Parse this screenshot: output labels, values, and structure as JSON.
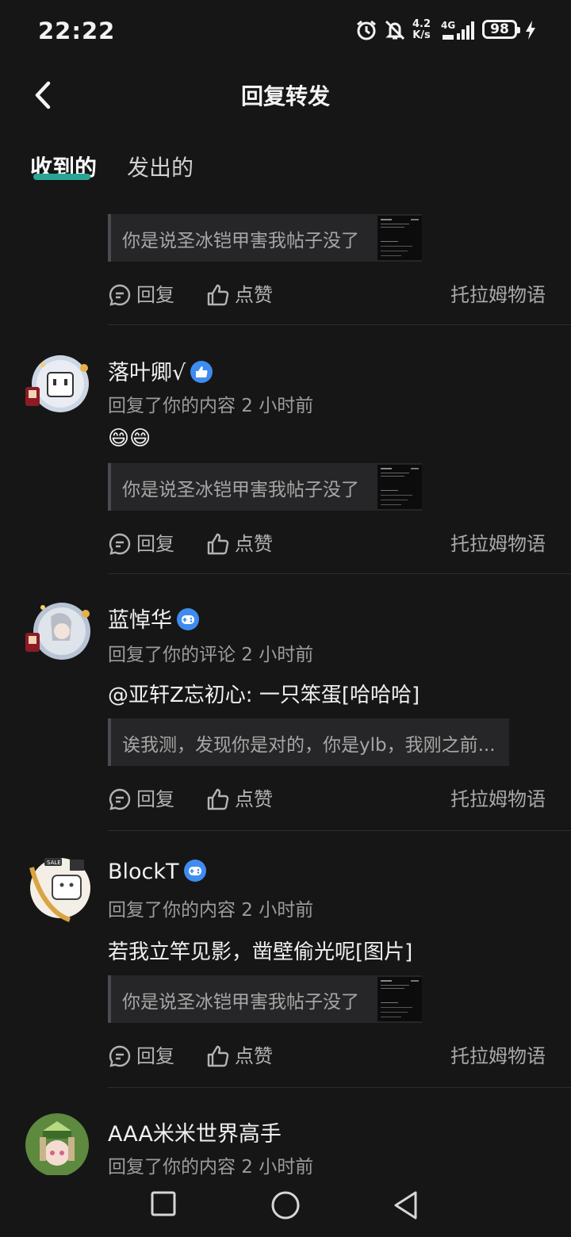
{
  "status_bar": {
    "time": "22:22",
    "net_speed_top": "4.2",
    "net_speed_bottom": "K/s",
    "network": "4G",
    "battery": "98"
  },
  "header": {
    "title": "回复转发"
  },
  "tabs": [
    {
      "label": "收到的",
      "active": true
    },
    {
      "label": "发出的",
      "active": false
    }
  ],
  "action_labels": {
    "reply": "回复",
    "like": "点赞"
  },
  "items": [
    {
      "quote": "你是说圣冰铠甲害我帖子没了",
      "source": "托拉姆物语"
    },
    {
      "name": "落叶卿√",
      "meta": "回复了你的内容 2 小时前",
      "body": "😄😄",
      "quote": "你是说圣冰铠甲害我帖子没了",
      "source": "托拉姆物语"
    },
    {
      "name": "蓝悼华",
      "meta": "回复了你的评论 2 小时前",
      "body": "@亚轩Z忘初心: 一只笨蛋[哈哈哈]",
      "quote": "诶我测，发现你是对的，你是ylb，我刚之前...",
      "source": "托拉姆物语"
    },
    {
      "name": "BlockT",
      "meta": "回复了你的内容 2 小时前",
      "body": "若我立竿见影，凿壁偷光呢[图片]",
      "quote": "你是说圣冰铠甲害我帖子没了",
      "source": "托拉姆物语"
    },
    {
      "name": "AAA米米世界高手",
      "meta": "回复了你的内容 2 小时前"
    }
  ],
  "colors": {
    "background": "#161616",
    "accent": "#2aa597",
    "quote_bg": "#262628",
    "badge_blue": "#3f8cf0"
  }
}
